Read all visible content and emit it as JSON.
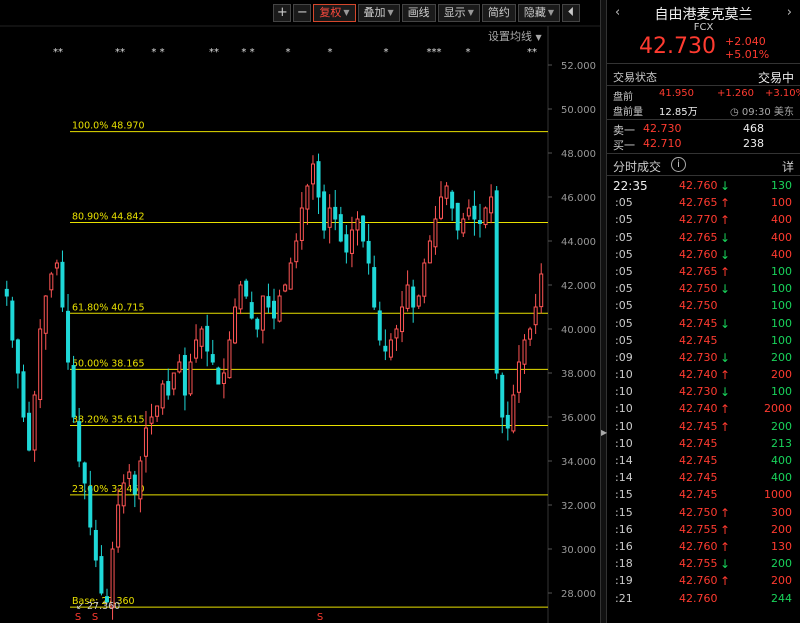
{
  "toolbar": {
    "zoom_in": "+",
    "zoom_out": "−",
    "rights": "复权",
    "overlay": "叠加",
    "draw": "画线",
    "display": "显示",
    "simple": "简约",
    "hide": "隐藏",
    "collapse_icon": "⏴"
  },
  "ma_setting": "设置均线",
  "colors": {
    "up": "#ff3b30",
    "down": "#19d35b",
    "fib": "#e8e000",
    "candle_up": "#ff5555",
    "candle_down": "#1fd8d8"
  },
  "chart_data": {
    "type": "candlestick",
    "y_axis": {
      "min": 27,
      "max": 53,
      "ticks": [
        "52.000",
        "50.000",
        "48.000",
        "46.000",
        "44.000",
        "42.000",
        "40.000",
        "38.000",
        "36.000",
        "34.000",
        "32.000",
        "30.000",
        "28.000"
      ]
    },
    "fib_levels": [
      {
        "label": "100.0% 48.970",
        "value": 48.97
      },
      {
        "label": "80.90% 44.842",
        "value": 44.842
      },
      {
        "label": "61.80% 40.715",
        "value": 40.715
      },
      {
        "label": "50.00% 38.165",
        "value": 38.165
      },
      {
        "label": "38.20% 35.615",
        "value": 35.615
      },
      {
        "label": "23.60% 32.460",
        "value": 32.46
      },
      {
        "label": "Base: 27.360",
        "value": 27.36
      }
    ],
    "low_marker": "27.360",
    "event_markers": [
      "**",
      "**",
      "* *",
      "**",
      "* *",
      "*",
      "*",
      "*",
      "***",
      "*",
      "**"
    ],
    "bottom_markers": [
      "S",
      "S",
      "S"
    ],
    "close_path": [
      41.5,
      39.5,
      38.0,
      36.0,
      34.5,
      37.0,
      40.0,
      41.5,
      42.5,
      43.0,
      41.0,
      38.5,
      36.0,
      34.0,
      33.0,
      31.0,
      29.5,
      28.0,
      27.6,
      30.0,
      32.0,
      33.0,
      33.5,
      32.5,
      34.0,
      35.5,
      36.0,
      36.5,
      37.5,
      37.0,
      38.0,
      38.5,
      37.0,
      38.5,
      39.5,
      40.0,
      39.0,
      38.5,
      37.5,
      38.0,
      39.5,
      41.0,
      42.0,
      41.5,
      40.5,
      40.0,
      41.5,
      41.0,
      40.5,
      41.5,
      42.0,
      43.0,
      44.0,
      45.5,
      46.5,
      47.5,
      46.0,
      44.5,
      45.5,
      45.0,
      44.0,
      43.5,
      44.5,
      45.0,
      44.0,
      43.0,
      41.0,
      39.5,
      39.0,
      39.5,
      40.0,
      41.0,
      42.0,
      41.0,
      41.5,
      43.0,
      44.0,
      45.0,
      46.0,
      46.5,
      45.5,
      44.5,
      45.0,
      45.5,
      45.0,
      44.8,
      45.5,
      46.0,
      38.0,
      36.0,
      35.5,
      37.0,
      38.5,
      39.5,
      40.0,
      41.0,
      42.5
    ]
  },
  "quote": {
    "back_icon": "‹",
    "forward_icon": "›",
    "name": "自由港麦克莫兰",
    "code": "FCX",
    "price": "42.730",
    "change": "+2.040",
    "change_pct": "+5.01%"
  },
  "status": {
    "label": "交易状态",
    "value": "交易中"
  },
  "premarket": {
    "price_label": "盘前",
    "price": "41.950",
    "change": "+1.260",
    "change_pct": "+3.10%",
    "volume_label": "盘前量",
    "volume": "12.85万",
    "time": "◷ 09:30 美东"
  },
  "book": {
    "ask_label": "卖一",
    "ask_price": "42.730",
    "ask_vol": "468",
    "bid_label": "买一",
    "bid_price": "42.710",
    "bid_vol": "238"
  },
  "ticks_header": {
    "label": "分时成交",
    "info": "i",
    "detail": "详"
  },
  "ticks": [
    {
      "time": "22:35",
      "price": "42.760",
      "dir": "down",
      "vol": "130",
      "vcolor": "green",
      "main": true
    },
    {
      "time": ":05",
      "price": "42.765",
      "dir": "up",
      "vol": "100",
      "vcolor": "red"
    },
    {
      "time": ":05",
      "price": "42.770",
      "dir": "up",
      "vol": "400",
      "vcolor": "red"
    },
    {
      "time": ":05",
      "price": "42.765",
      "dir": "down",
      "vol": "400",
      "vcolor": "red"
    },
    {
      "time": ":05",
      "price": "42.760",
      "dir": "down",
      "vol": "400",
      "vcolor": "red"
    },
    {
      "time": ":05",
      "price": "42.765",
      "dir": "up",
      "vol": "100",
      "vcolor": "green"
    },
    {
      "time": ":05",
      "price": "42.750",
      "dir": "down",
      "vol": "100",
      "vcolor": "green"
    },
    {
      "time": ":05",
      "price": "42.750",
      "dir": "",
      "vol": "100",
      "vcolor": "green"
    },
    {
      "time": ":05",
      "price": "42.745",
      "dir": "down",
      "vol": "100",
      "vcolor": "green"
    },
    {
      "time": ":05",
      "price": "42.745",
      "dir": "",
      "vol": "100",
      "vcolor": "green"
    },
    {
      "time": ":09",
      "price": "42.730",
      "dir": "down",
      "vol": "200",
      "vcolor": "green"
    },
    {
      "time": ":10",
      "price": "42.740",
      "dir": "up",
      "vol": "200",
      "vcolor": "red"
    },
    {
      "time": ":10",
      "price": "42.730",
      "dir": "down",
      "vol": "100",
      "vcolor": "green"
    },
    {
      "time": ":10",
      "price": "42.740",
      "dir": "up",
      "vol": "2000",
      "vcolor": "red"
    },
    {
      "time": ":10",
      "price": "42.745",
      "dir": "up",
      "vol": "200",
      "vcolor": "green"
    },
    {
      "time": ":10",
      "price": "42.745",
      "dir": "",
      "vol": "213",
      "vcolor": "green"
    },
    {
      "time": ":14",
      "price": "42.745",
      "dir": "",
      "vol": "400",
      "vcolor": "green"
    },
    {
      "time": ":14",
      "price": "42.745",
      "dir": "",
      "vol": "400",
      "vcolor": "green"
    },
    {
      "time": ":15",
      "price": "42.745",
      "dir": "",
      "vol": "1000",
      "vcolor": "red"
    },
    {
      "time": ":15",
      "price": "42.750",
      "dir": "up",
      "vol": "300",
      "vcolor": "red"
    },
    {
      "time": ":16",
      "price": "42.755",
      "dir": "up",
      "vol": "200",
      "vcolor": "red"
    },
    {
      "time": ":16",
      "price": "42.760",
      "dir": "up",
      "vol": "130",
      "vcolor": "red"
    },
    {
      "time": ":18",
      "price": "42.755",
      "dir": "down",
      "vol": "200",
      "vcolor": "green"
    },
    {
      "time": ":19",
      "price": "42.760",
      "dir": "up",
      "vol": "200",
      "vcolor": "red"
    },
    {
      "time": ":21",
      "price": "42.760",
      "dir": "",
      "vol": "244",
      "vcolor": "green"
    }
  ]
}
